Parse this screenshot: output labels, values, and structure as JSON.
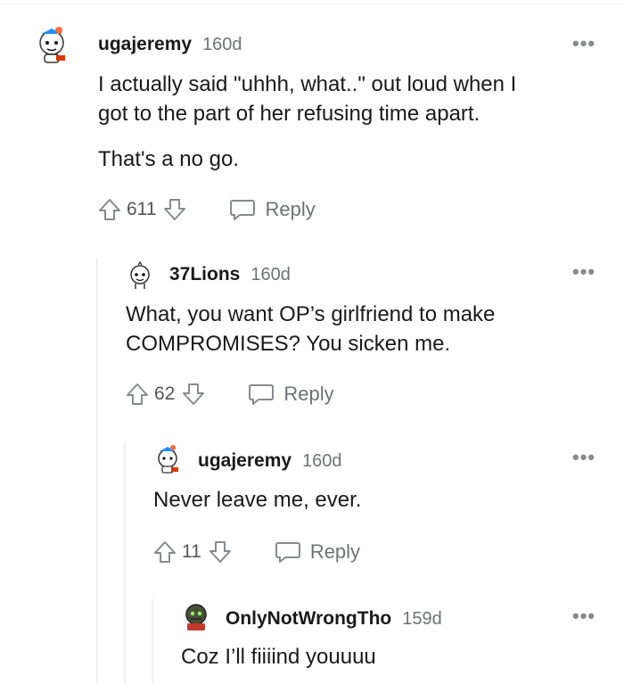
{
  "comments": [
    {
      "username": "ugajeremy",
      "age": "160d",
      "body": [
        "I actually said \"uhhh, what..\" out loud when I",
        "got to the part of her refusing time apart."
      ],
      "body2": "That's a no go.",
      "score": "611",
      "reply_label": "Reply",
      "more": "•••",
      "avatar_icon": "robot-avatar-icon"
    },
    {
      "username": "37Lions",
      "age": "160d",
      "body": [
        "What, you want OP’s girlfriend to make",
        "COMPROMISES? You sicken me."
      ],
      "score": "62",
      "reply_label": "Reply",
      "more": "•••",
      "avatar_icon": "robot-avatar-icon"
    },
    {
      "username": "ugajeremy",
      "age": "160d",
      "body": [
        "Never leave me, ever."
      ],
      "score": "11",
      "reply_label": "Reply",
      "more": "•••",
      "avatar_icon": "robot-avatar-icon"
    },
    {
      "username": "OnlyNotWrongTho",
      "age": "159d",
      "body": [
        "Coz I’ll fiiiind youuuu"
      ],
      "more": "•••",
      "avatar_icon": "robot-avatar-icon"
    }
  ]
}
